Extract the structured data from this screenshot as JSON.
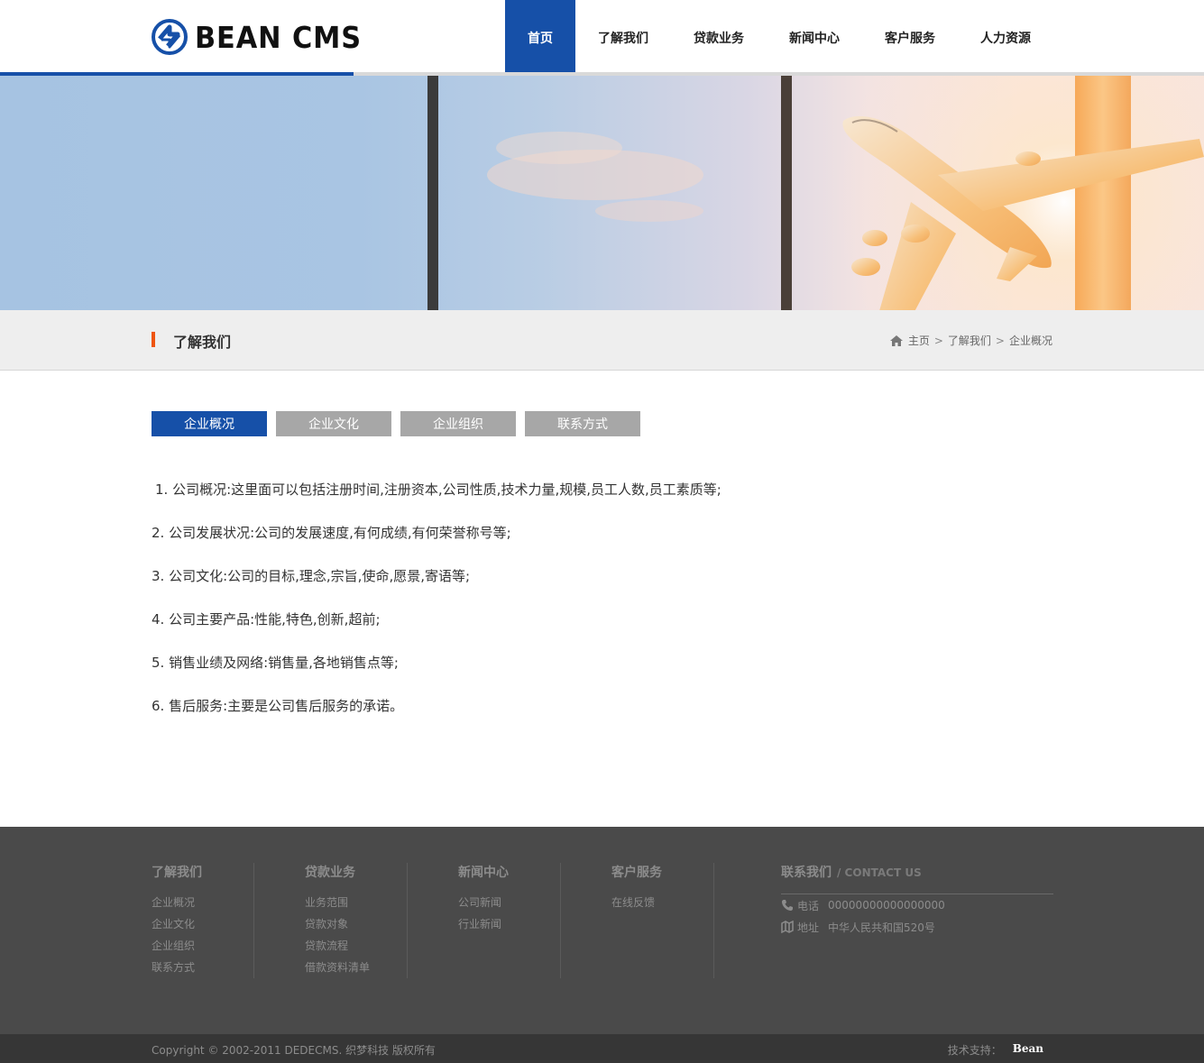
{
  "brand": {
    "name": "BEAN CMS",
    "logo_icon": "bean-logo-icon"
  },
  "nav": {
    "items": [
      {
        "label": "首页",
        "active": true
      },
      {
        "label": "了解我们",
        "active": false
      },
      {
        "label": "贷款业务",
        "active": false
      },
      {
        "label": "新闻中心",
        "active": false
      },
      {
        "label": "客户服务",
        "active": false
      },
      {
        "label": "人力资源",
        "active": false
      }
    ]
  },
  "banner": {
    "image": "airplane-sky-banner"
  },
  "section": {
    "title": "了解我们",
    "breadcrumb": {
      "home_icon": "home-icon",
      "home": "主页",
      "sep": ">",
      "parent": "了解我们",
      "current": "企业概况"
    }
  },
  "tabs": [
    {
      "label": "企业概况",
      "active": true
    },
    {
      "label": "企业文化",
      "active": false
    },
    {
      "label": "企业组织",
      "active": false
    },
    {
      "label": "联系方式",
      "active": false
    }
  ],
  "content": {
    "lines": [
      "1. 公司概况:这里面可以包括注册时间,注册资本,公司性质,技术力量,规模,员工人数,员工素质等;",
      "2. 公司发展状况:公司的发展速度,有何成绩,有何荣誉称号等;",
      "3. 公司文化:公司的目标,理念,宗旨,使命,愿景,寄语等;",
      "4. 公司主要产品:性能,特色,创新,超前;",
      "5. 销售业绩及网络:销售量,各地销售点等;",
      "6. 售后服务:主要是公司售后服务的承诺。"
    ]
  },
  "footer": {
    "columns": [
      {
        "title": "了解我们",
        "links": [
          "企业概况",
          "企业文化",
          "企业组织",
          "联系方式"
        ]
      },
      {
        "title": "贷款业务",
        "links": [
          "业务范围",
          "贷款对象",
          "贷款流程",
          "借款资料清单"
        ]
      },
      {
        "title": "新闻中心",
        "links": [
          "公司新闻",
          "行业新闻"
        ]
      },
      {
        "title": "客户服务",
        "links": [
          "在线反馈"
        ]
      }
    ],
    "contact": {
      "title": "联系我们",
      "title_en": "/ CONTACT US",
      "phone_label": "电话",
      "phone": "00000000000000000",
      "address_label": "地址",
      "address": "中华人民共和国520号"
    },
    "copyright": "Copyright © 2002-2011 DEDECMS. 织梦科技 版权所有",
    "support_label": "技术支持：",
    "support_brand": "Bean"
  },
  "colors": {
    "primary": "#1650a8",
    "accent": "#ee5511",
    "footer_bg": "#4a4a4a",
    "copyright_bg": "#363636",
    "tab_inactive": "#a7a7a7"
  }
}
